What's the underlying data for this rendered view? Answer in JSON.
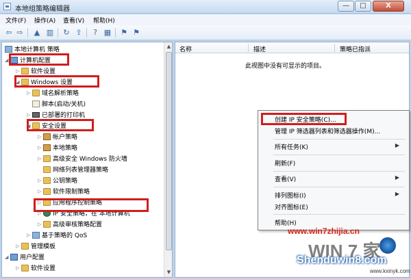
{
  "window": {
    "title": "本地组策略编辑器",
    "min_label": "—",
    "max_label": "□",
    "close_label": "X"
  },
  "menu": [
    {
      "label": "文件(F)"
    },
    {
      "label": "操作(A)"
    },
    {
      "label": "查看(V)"
    },
    {
      "label": "帮助(H)"
    }
  ],
  "toolbar": {
    "back_icon": "⇦",
    "forward_icon": "⇨",
    "up_icon": "▲",
    "show_tree_icon": "▥",
    "refresh_icon": "↻",
    "export_icon": "⇪",
    "help_icon": "?",
    "properties_icon": "▦",
    "action_icon": "⚑"
  },
  "tree": {
    "scroll_up": "▲",
    "scroll_down": "▼",
    "items": [
      {
        "label": "本地计算机 策略",
        "arrow": ""
      },
      {
        "label": "计算机配置",
        "arrow": "◢"
      },
      {
        "label": "软件设置",
        "arrow": "▷"
      },
      {
        "label": "Windows 设置",
        "arrow": "◢"
      },
      {
        "label": "域名解析策略",
        "arrow": "▷"
      },
      {
        "label": "脚本(启动/关机)",
        "arrow": ""
      },
      {
        "label": "已部署的打印机",
        "arrow": "▷"
      },
      {
        "label": "安全设置",
        "arrow": "◢"
      },
      {
        "label": "帐户策略",
        "arrow": "▷"
      },
      {
        "label": "本地策略",
        "arrow": "▷"
      },
      {
        "label": "高级安全 Windows 防火墙",
        "arrow": "▷"
      },
      {
        "label": "网络列表管理器策略",
        "arrow": ""
      },
      {
        "label": "公钥策略",
        "arrow": "▷"
      },
      {
        "label": "软件限制策略",
        "arrow": "▷"
      },
      {
        "label": "应用程序控制策略",
        "arrow": "▷"
      },
      {
        "label": "IP 安全策略，在 本地计算机",
        "arrow": "▷"
      },
      {
        "label": "高级审核策略配置",
        "arrow": "▷"
      },
      {
        "label": "基于策略的 QoS",
        "arrow": "▷"
      },
      {
        "label": "管理模板",
        "arrow": "▷"
      },
      {
        "label": "用户配置",
        "arrow": "◢"
      },
      {
        "label": "软件设置",
        "arrow": "▷"
      }
    ]
  },
  "list": {
    "columns": [
      "名称",
      "描述",
      "策略已指派"
    ],
    "empty_message": "此视图中没有可显示的项目。"
  },
  "context_menu": {
    "items": [
      {
        "label": "创建 IP 安全策略(C)...",
        "arrow": ""
      },
      {
        "label": "管理 IP 筛选器列表和筛选器操作(M)...",
        "arrow": ""
      },
      {
        "label": "所有任务(K)",
        "arrow": "▶"
      },
      {
        "label": "刷新(F)",
        "arrow": ""
      },
      {
        "label": "查看(V)",
        "arrow": "▶"
      },
      {
        "label": "排列图标(I)",
        "arrow": "▶"
      },
      {
        "label": "对齐图标(E)",
        "arrow": ""
      },
      {
        "label": "帮助(H)",
        "arrow": ""
      }
    ]
  },
  "watermark": {
    "url": "www.win7zhijia.cn",
    "logo_text": "WIN 7 家",
    "site": "Shenduwin8.com",
    "sub": "www.kxinyk.com"
  }
}
